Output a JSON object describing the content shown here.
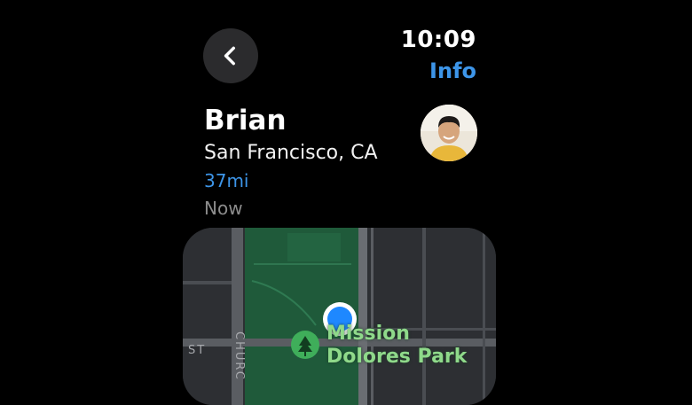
{
  "status": {
    "time": "10:09"
  },
  "header": {
    "info_label": "Info"
  },
  "contact": {
    "name": "Brian",
    "location": "San Francisco, CA",
    "distance": "37mi",
    "updated": "Now"
  },
  "map": {
    "poi_line1": "Mission",
    "poi_line2": "Dolores Park",
    "street_st": "ST",
    "street_church": "CHURC",
    "colors": {
      "park": "#1f5a3a",
      "road": "#5a5d62",
      "land": "#2d2f33",
      "pin": "#1e88ff"
    }
  },
  "icons": {
    "back": "chevron-left-icon",
    "poi": "tree-icon",
    "pin": "location-pin-icon"
  }
}
